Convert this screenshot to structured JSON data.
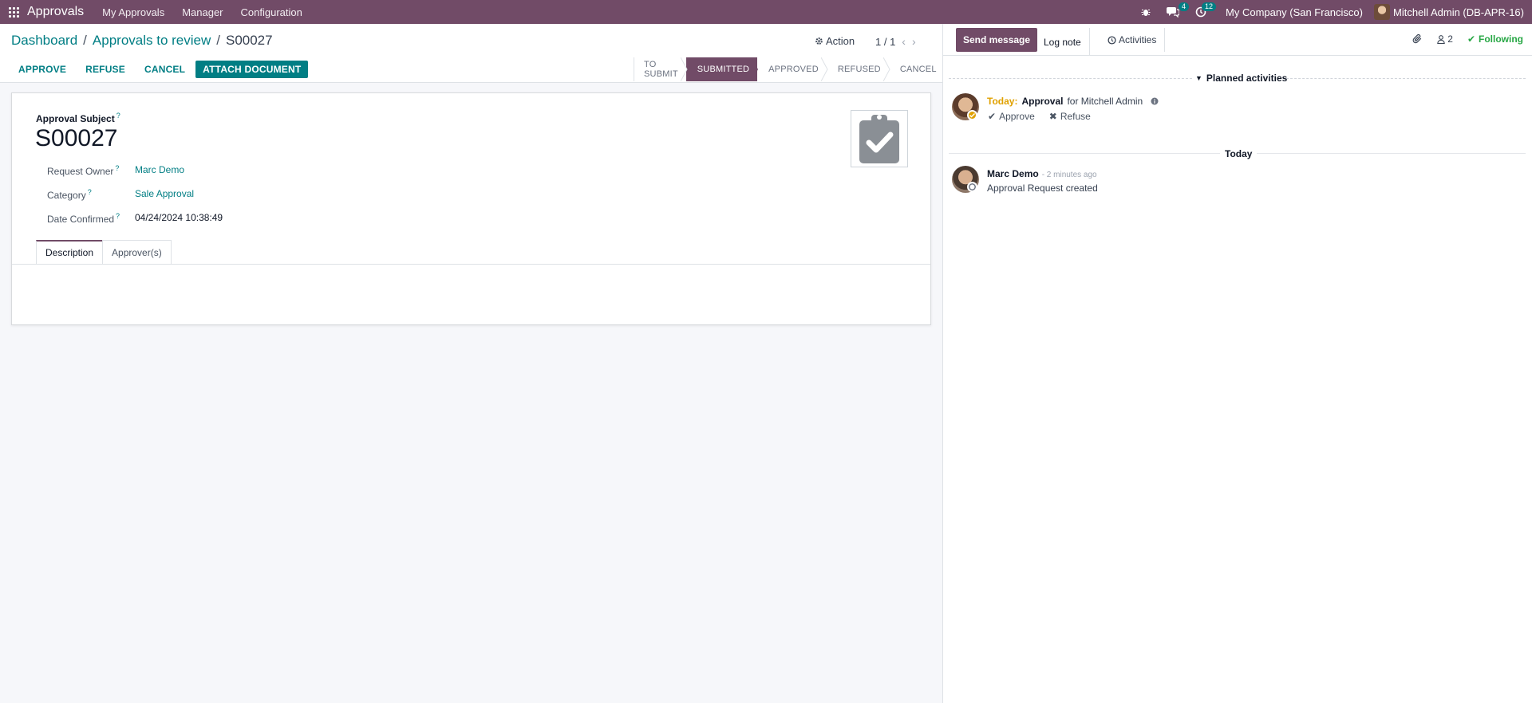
{
  "navbar": {
    "app_name": "Approvals",
    "menu": [
      "My Approvals",
      "Manager",
      "Configuration"
    ],
    "messages_count": "4",
    "activities_count": "12",
    "company": "My Company (San Francisco)",
    "user": "Mitchell Admin (DB-APR-16)"
  },
  "breadcrumb": {
    "items": [
      "Dashboard",
      "Approvals to review"
    ],
    "current": "S00027"
  },
  "controls": {
    "action_label": "Action",
    "pager": "1 / 1"
  },
  "buttons": {
    "approve": "APPROVE",
    "refuse": "REFUSE",
    "cancel": "CANCEL",
    "attach": "ATTACH DOCUMENT"
  },
  "statusbar": {
    "stages": [
      "TO SUBMIT",
      "SUBMITTED",
      "APPROVED",
      "REFUSED",
      "CANCEL"
    ],
    "active": "SUBMITTED"
  },
  "form": {
    "subject_label": "Approval Subject",
    "subject": "S00027",
    "fields": [
      {
        "label": "Request Owner",
        "value": "Marc Demo"
      },
      {
        "label": "Category",
        "value": "Sale Approval"
      },
      {
        "label": "Date Confirmed",
        "value": "04/24/2024 10:38:49"
      }
    ],
    "tabs": [
      "Description",
      "Approver(s)"
    ],
    "tooltip_mark": "?"
  },
  "chatter": {
    "send_message": "Send message",
    "log_note": "Log note",
    "activities": "Activities",
    "followers_count": "2",
    "following": "Following",
    "planned_label": "Planned activities",
    "activity": {
      "today": "Today:",
      "title": "Approval",
      "for_text": "for Mitchell Admin",
      "approve": "Approve",
      "refuse": "Refuse"
    },
    "today_divider": "Today",
    "message": {
      "author": "Marc Demo",
      "time": "- 2 minutes ago",
      "body": "Approval Request created"
    }
  },
  "colors": {
    "brand": "#714b67",
    "accent": "#017e84",
    "following": "#28a745",
    "today": "#e0a100"
  }
}
